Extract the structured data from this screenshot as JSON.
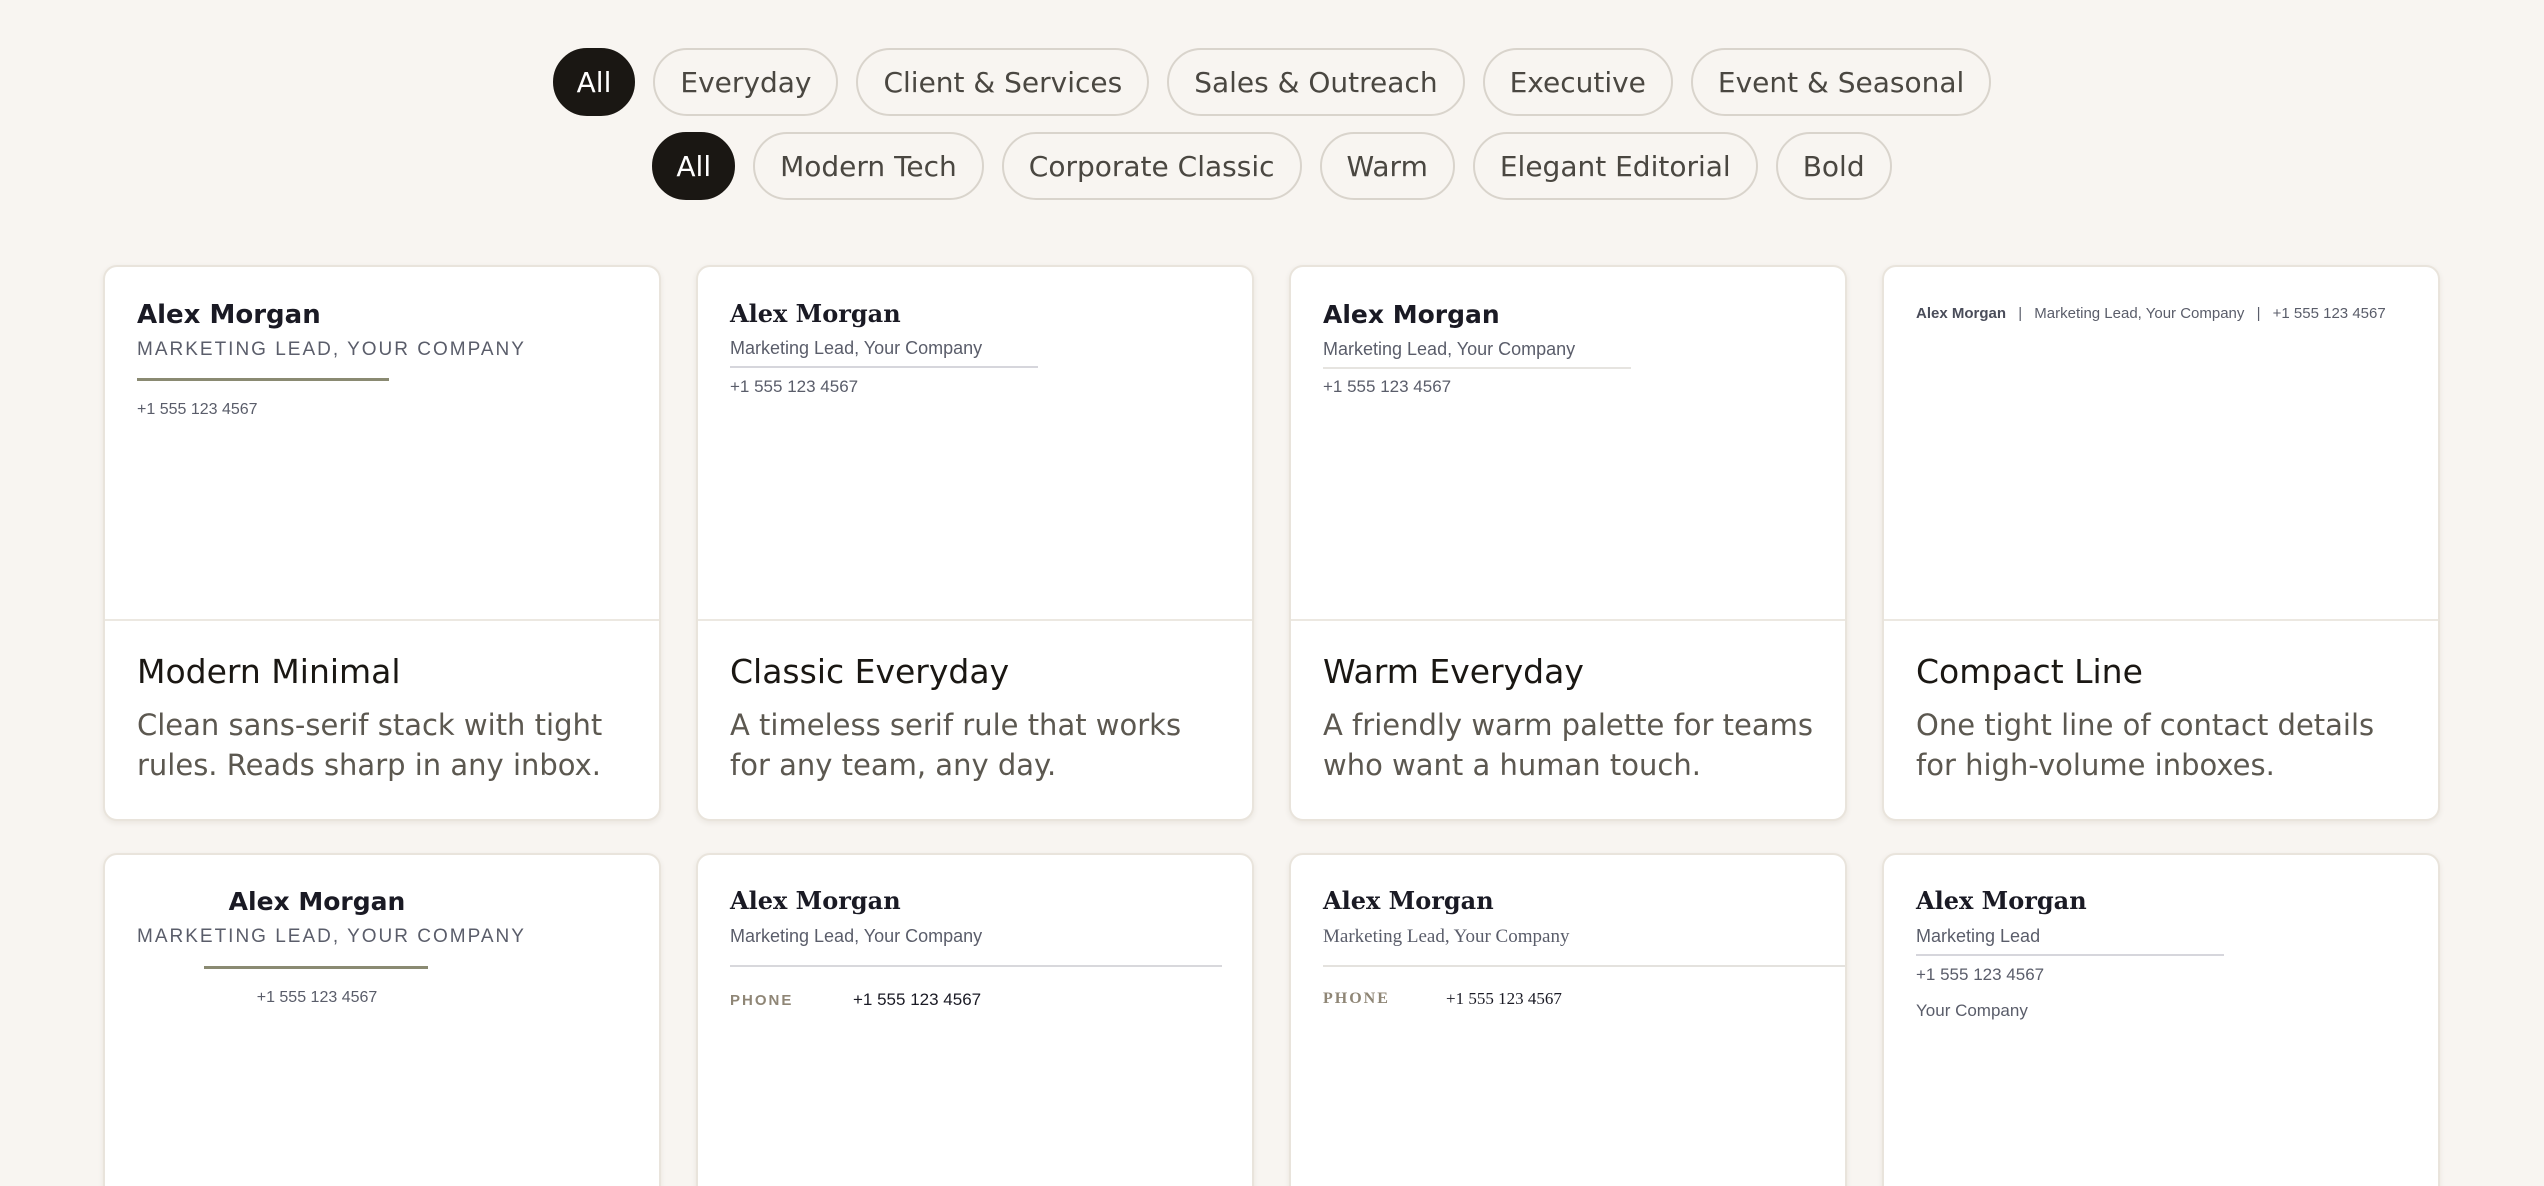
{
  "filters": {
    "category": [
      "All",
      "Everyday",
      "Client & Services",
      "Sales & Outreach",
      "Executive",
      "Event & Seasonal"
    ],
    "style": [
      "All",
      "Modern Tech",
      "Corporate Classic",
      "Warm",
      "Elegant Editorial",
      "Bold"
    ],
    "active_category": "All",
    "active_style": "All"
  },
  "signature": {
    "name": "Alex Morgan",
    "role_company": "Marketing Lead, Your Company",
    "role_company_caps": "MARKETING LEAD, YOUR COMPANY",
    "role": "Marketing Lead",
    "company": "Your Company",
    "phone": "+1 555 123 4567",
    "phone_label": "PHONE",
    "separator": "|"
  },
  "templates": [
    {
      "title": "Modern Minimal",
      "description": "Clean sans-serif stack with tight rules. Reads sharp in any inbox."
    },
    {
      "title": "Classic Everyday",
      "description": "A timeless serif rule that works for any team, any day."
    },
    {
      "title": "Warm Everyday",
      "description": "A friendly warm palette for teams who want a human touch."
    },
    {
      "title": "Compact Line",
      "description": "One tight line of contact details for high-volume inboxes."
    }
  ],
  "colors": {
    "background": "#f8f5f1",
    "pill_active": "#1a1713",
    "accent_rule": "#8a8a72",
    "label_taupe": "#8f8676"
  }
}
